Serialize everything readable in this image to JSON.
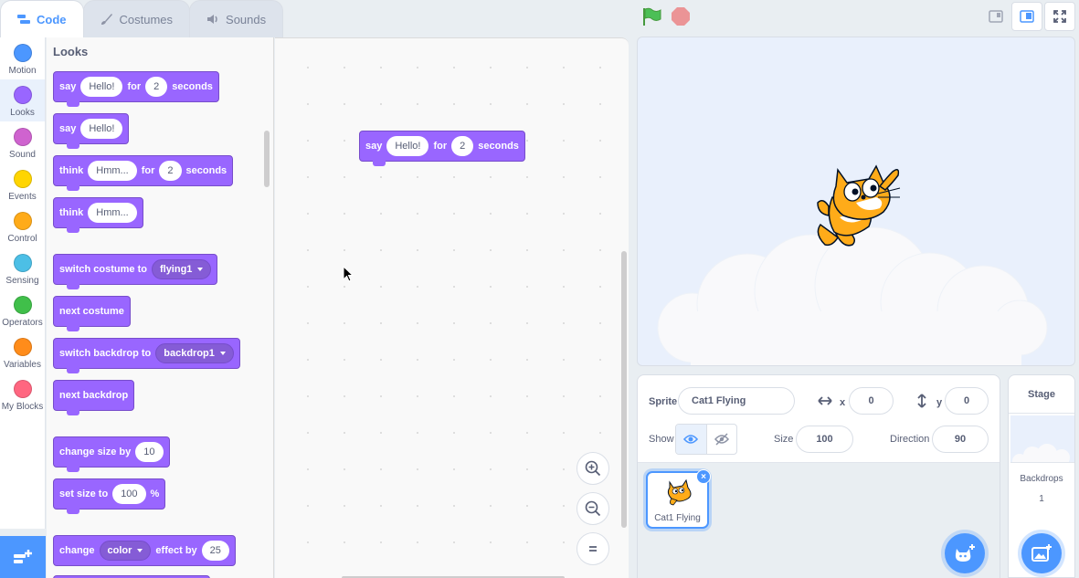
{
  "tabs": [
    {
      "label": "Code",
      "icon": "code-icon"
    },
    {
      "label": "Costumes",
      "icon": "brush-icon"
    },
    {
      "label": "Sounds",
      "icon": "speaker-icon"
    }
  ],
  "categories": [
    {
      "label": "Motion",
      "color": "#4c97ff"
    },
    {
      "label": "Looks",
      "color": "#9966ff"
    },
    {
      "label": "Sound",
      "color": "#cf63cf"
    },
    {
      "label": "Events",
      "color": "#ffd500"
    },
    {
      "label": "Control",
      "color": "#ffab19"
    },
    {
      "label": "Sensing",
      "color": "#4cbfe6"
    },
    {
      "label": "Operators",
      "color": "#40bf4a"
    },
    {
      "label": "Variables",
      "color": "#ff8c1a"
    },
    {
      "label": "My Blocks",
      "color": "#ff6680"
    }
  ],
  "palette": {
    "title": "Looks",
    "say_for": {
      "verb": "say",
      "message": "Hello!",
      "for": "for",
      "secs": "2",
      "unit": "seconds"
    },
    "say": {
      "verb": "say",
      "message": "Hello!"
    },
    "think_for": {
      "verb": "think",
      "message": "Hmm...",
      "for": "for",
      "secs": "2",
      "unit": "seconds"
    },
    "think": {
      "verb": "think",
      "message": "Hmm..."
    },
    "switch_costume": {
      "text": "switch costume to",
      "value": "flying1"
    },
    "next_costume": "next costume",
    "switch_backdrop": {
      "text": "switch backdrop to",
      "value": "backdrop1"
    },
    "next_backdrop": "next backdrop",
    "change_size": {
      "text": "change size by",
      "value": "10"
    },
    "set_size": {
      "text": "set size to",
      "value": "100",
      "unit": "%"
    },
    "change_effect": {
      "text": "change",
      "effect": "color",
      "by": "effect by",
      "value": "25"
    }
  },
  "workspace": {
    "block": {
      "verb": "say",
      "message": "Hello!",
      "for": "for",
      "secs": "2",
      "unit": "seconds"
    }
  },
  "sprite": {
    "label_sprite": "Sprite",
    "name": "Cat1 Flying",
    "label_x": "x",
    "x": "0",
    "label_y": "y",
    "y": "0",
    "label_show": "Show",
    "label_size": "Size",
    "size": "100",
    "label_direction": "Direction",
    "direction": "90",
    "tile_name": "Cat1 Flying"
  },
  "stage_pane": {
    "header": "Stage",
    "backdrops_label": "Backdrops",
    "backdrops_count": "1"
  },
  "colors": {
    "accent": "#4c97ff",
    "looks": "#9966ff",
    "flag": "#4cbf56",
    "stop": "#ec5959"
  }
}
